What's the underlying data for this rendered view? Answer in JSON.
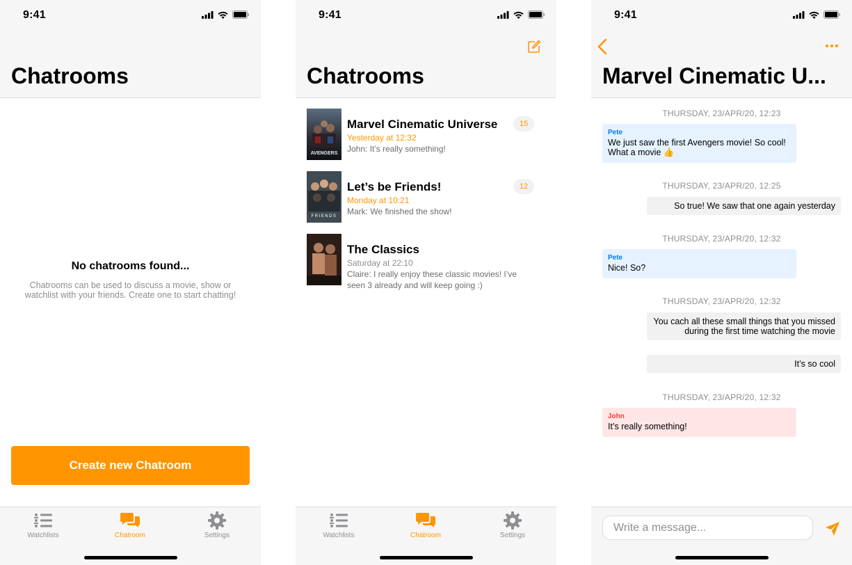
{
  "status_bar": {
    "time": "9:41"
  },
  "tabs": [
    {
      "label": "Watchlists",
      "icon": "list-icon"
    },
    {
      "label": "Chatroom",
      "icon": "chat-bubbles-icon"
    },
    {
      "label": "Settings",
      "icon": "gear-icon"
    }
  ],
  "screen_empty": {
    "title": "Chatrooms",
    "empty_title": "No chatrooms found...",
    "empty_desc": "Chatrooms can be used to discuss a movie, show or watchlist with your friends. Create one to start chatting!",
    "create_button": "Create new Chatroom"
  },
  "screen_list": {
    "title": "Chatrooms",
    "rooms": [
      {
        "name": "Marvel Cinematic Universe",
        "time": "Yesterday at 12:32",
        "message": "John: It’s really something!",
        "badge": "15",
        "poster_text": "AVENGERS"
      },
      {
        "name": "Let’s be Friends!",
        "time": "Monday at 10:21",
        "message": "Mark: We finished the show!",
        "badge": "12",
        "poster_text": "FRIENDS"
      },
      {
        "name": "The Classics",
        "time": "Saturday at 22:10",
        "message": "Claire: I really enjoy these classic movies! I’ve seen 3 already and will keep going :)"
      }
    ]
  },
  "screen_chat": {
    "title": "Marvel Cinematic U...",
    "messages": [
      {
        "date": "THURSDAY, 23/APR/20, 12:23",
        "sender": "Pete",
        "text": "We just saw the first Avengers movie! So cool! What a movie 👍"
      },
      {
        "date": "THURSDAY, 23/APR/20, 12:25",
        "text": "So true! We saw that one again yesterday"
      },
      {
        "date": "THURSDAY, 23/APR/20, 12:32",
        "sender": "Pete",
        "text": "Nice! So?"
      },
      {
        "date": "THURSDAY, 23/APR/20, 12:32",
        "text": "You cach all these small things that you missed during the first time watching the movie"
      },
      {
        "text": "It’s so cool"
      },
      {
        "date": "THURSDAY, 23/APR/20, 12:32",
        "sender": "John",
        "text": "It’s really something!"
      }
    ],
    "input_placeholder": "Write a message..."
  },
  "colors": {
    "accent": "#ff9500",
    "blue": "#007aff",
    "red": "#ff3b30",
    "bar_bg": "#f6f6f6"
  }
}
